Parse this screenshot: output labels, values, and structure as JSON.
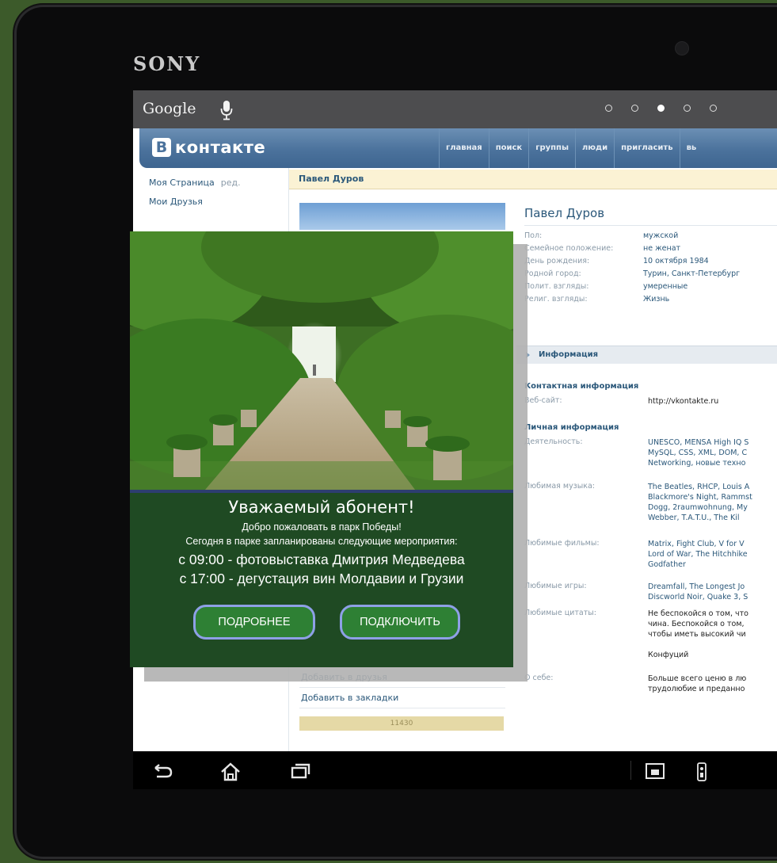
{
  "device": {
    "brand": "SONY"
  },
  "search_bar": {
    "label": "Google"
  },
  "vk": {
    "logo_letter": "В",
    "logo_text": "контакте",
    "nav": [
      "главная",
      "поиск",
      "группы",
      "люди",
      "пригласить",
      "вь"
    ],
    "left_menu": [
      {
        "label": "Моя Страница",
        "sub": "ред."
      },
      {
        "label": "Мои Друзья",
        "sub": ""
      }
    ],
    "profile_bar_title": "Павел Дуров",
    "profile_name": "Павел Дуров",
    "basic_info": [
      {
        "label": "Пол:",
        "value": "мужской"
      },
      {
        "label": "Семейное положение:",
        "value": "не женат"
      },
      {
        "label": "День рождения:",
        "value": "10 октября 1984"
      },
      {
        "label": "Родной город:",
        "value": "Турин, Санкт-Петербург"
      },
      {
        "label": "Полит. взгляды:",
        "value": "умеренные"
      },
      {
        "label": "Религ. взгляды:",
        "value": "Жизнь"
      }
    ],
    "section_title": "Информация",
    "contact_heading": "Контактная информация",
    "website": {
      "label": "Веб-сайт:",
      "value": "http://vkontakte.ru"
    },
    "personal_heading": "Личная информация",
    "activity": {
      "label": "Деятельность:",
      "lines": [
        "UNESCO, MENSA High IQ S",
        "MySQL, CSS, XML, DOM, C",
        "Networking, новые техно"
      ]
    },
    "music": {
      "label": "Любимая музыка:",
      "lines": [
        "The Beatles, RHCP, Louis A",
        "Blackmore's Night, Rammst",
        "Dogg, 2raumwohnung, My",
        "Webber, T.A.T.U., The Kil"
      ]
    },
    "films": {
      "label": "Любимые фильмы:",
      "lines": [
        "Matrix, Fight Club, V for V",
        "Lord of War, The Hitchhike",
        "Godfather"
      ]
    },
    "games": {
      "label": "Любимые игры:",
      "lines": [
        "Dreamfall, The Longest Jo",
        "Discworld Noir, Quake 3, S"
      ]
    },
    "quotes": {
      "label": "Любимые цитаты:",
      "lines": [
        "Не беспокойся о том, что",
        "чина. Беспокойся о том,",
        "чтобы иметь высокий чи",
        "",
        "Конфуций"
      ]
    },
    "about": {
      "label": "О себе:",
      "lines": [
        "Больше всего ценю в лю",
        "трудолюбие и преданно"
      ]
    },
    "photo_links": [
      "Добавить в друзья",
      "Добавить в закладки"
    ],
    "rating": "11430"
  },
  "popup": {
    "title": "Уважаемый абонент!",
    "line1": "Добро пожаловать в парк Победы!",
    "line2": "Сегодня в парке запланированы следующие мероприятия:",
    "event1": "с 09:00 - фотовыставка Дмитрия Медведева",
    "event2": "с 17:00 - дегустация вин Молдавии и Грузии",
    "btn_more": "ПОДРОБНЕЕ",
    "btn_connect": "ПОДКЛЮЧИТЬ"
  },
  "colors": {
    "vk_blue": "#4b729c",
    "popup_green": "#1f4a23",
    "button_green": "#2e8034",
    "button_border": "#8ea0e6"
  }
}
